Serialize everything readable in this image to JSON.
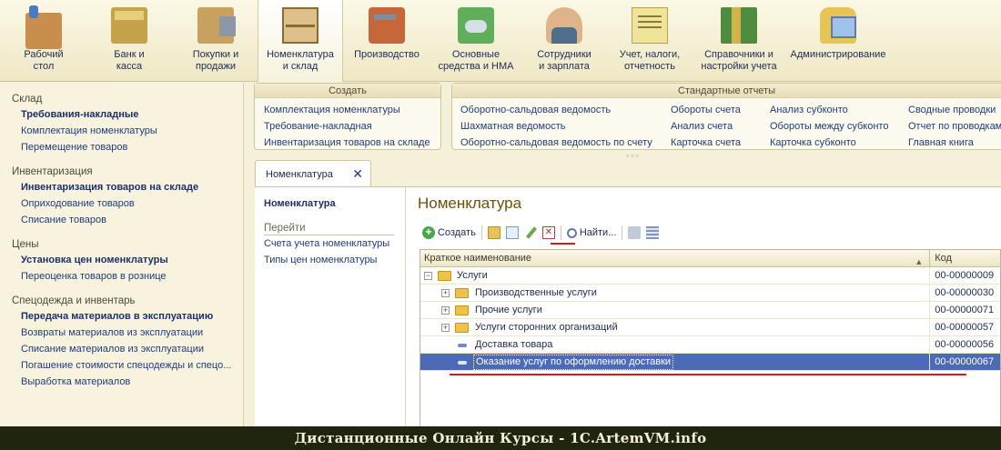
{
  "sections": [
    {
      "label": "Рабочий\nстол",
      "icon": "desktop-icon"
    },
    {
      "label": "Банк и\nкасса",
      "icon": "bank-icon"
    },
    {
      "label": "Покупки и\nпродажи",
      "icon": "truck-icon"
    },
    {
      "label": "Номенклатура\nи склад",
      "icon": "warehouse-icon",
      "active": true
    },
    {
      "label": "Производство",
      "icon": "toolbox-icon"
    },
    {
      "label": "Основные\nсредства и НМА",
      "icon": "equipment-icon"
    },
    {
      "label": "Сотрудники\nи зарплата",
      "icon": "employee-icon"
    },
    {
      "label": "Учет, налоги,\nотчетность",
      "icon": "reports-icon"
    },
    {
      "label": "Справочники и\nнастройки учета",
      "icon": "binders-icon"
    },
    {
      "label": "Администрирование",
      "icon": "admin-icon"
    }
  ],
  "leftnav": {
    "groups": [
      {
        "title": "Склад",
        "items": [
          {
            "label": "Требования-накладные",
            "bold": true
          },
          {
            "label": "Комплектация номенклатуры"
          },
          {
            "label": "Перемещение товаров"
          }
        ]
      },
      {
        "title": "Инвентаризация",
        "items": [
          {
            "label": "Инвентаризация товаров на складе",
            "bold": true
          },
          {
            "label": "Оприходование товаров"
          },
          {
            "label": "Списание товаров"
          }
        ]
      },
      {
        "title": "Цены",
        "items": [
          {
            "label": "Установка цен номенклатуры",
            "bold": true
          },
          {
            "label": "Переоценка товаров в рознице"
          }
        ]
      },
      {
        "title": "Спецодежда и инвентарь",
        "items": [
          {
            "label": "Передача материалов в эксплуатацию",
            "bold": true
          },
          {
            "label": "Возвраты материалов из эксплуатации"
          },
          {
            "label": "Списание материалов из эксплуатации"
          },
          {
            "label": "Погашение стоимости спецодежды и спецо..."
          },
          {
            "label": "Выработка материалов"
          }
        ]
      }
    ]
  },
  "create_panel": {
    "title": "Создать",
    "items": [
      "Комплектация номенклатуры",
      "Требование-накладная",
      "Инвентаризация товаров на складе"
    ]
  },
  "reports_panel": {
    "title": "Стандартные отчеты",
    "columns": [
      [
        "Оборотно-сальдовая ведомость",
        "Шахматная ведомость",
        "Оборотно-сальдовая ведомость по счету"
      ],
      [
        "Обороты счета",
        "Анализ счета",
        "Карточка счета"
      ],
      [
        "Анализ субконто",
        "Обороты между субконто",
        "Карточка субконто"
      ],
      [
        "Сводные проводки",
        "Отчет по проводкам",
        "Главная книга"
      ]
    ]
  },
  "tab": {
    "label": "Номенклатура",
    "close": "✕"
  },
  "subnav": {
    "current": "Номенклатура",
    "goto": "Перейти",
    "links": [
      "Счета учета номенклатуры",
      "Типы цен номенклатуры"
    ]
  },
  "form": {
    "title": "Номенклатура",
    "toolbar": {
      "create": "Создать",
      "find": "Найти..."
    }
  },
  "grid": {
    "columns": [
      "Краткое наименование",
      "Код"
    ],
    "rows": [
      {
        "name": "Услуги",
        "code": "00-00000009",
        "level": 0,
        "kind": "folder",
        "expander": "−"
      },
      {
        "name": "Производственные услуги",
        "code": "00-00000030",
        "level": 1,
        "kind": "folder",
        "expander": "+"
      },
      {
        "name": "Прочие услуги",
        "code": "00-00000071",
        "level": 1,
        "kind": "folder",
        "expander": "+"
      },
      {
        "name": "Услуги сторонних организаций",
        "code": "00-00000057",
        "level": 1,
        "kind": "folder",
        "expander": "+"
      },
      {
        "name": "Доставка товара",
        "code": "00-00000056",
        "level": 1,
        "kind": "item"
      },
      {
        "name": "Оказание услуг по оформлению доставки",
        "code": "00-00000067",
        "level": 1,
        "kind": "item",
        "selected": true
      }
    ]
  },
  "banner": {
    "text": "Дистанционные Онлайн Курсы - 1C.ArtemVM.info"
  },
  "colors": {
    "accent_red": "#d21c1c",
    "selection": "#4b6ab9",
    "title": "#6d4f08"
  }
}
